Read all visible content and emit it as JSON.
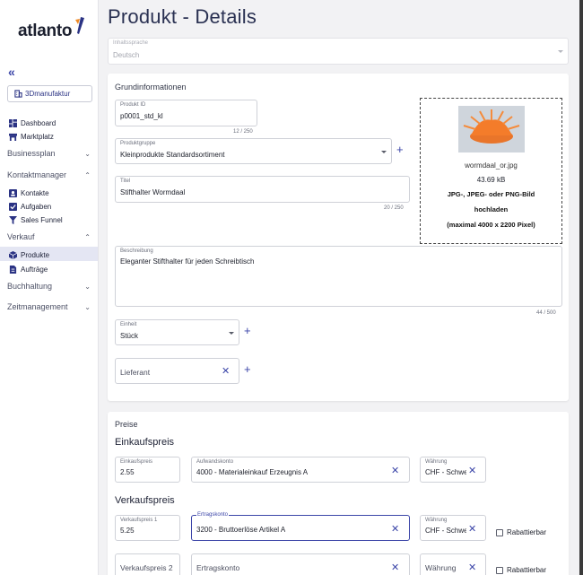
{
  "app": {
    "logo_text": "atlanto",
    "brand_color": "#3b45a8"
  },
  "sidebar": {
    "company_label": "3Dmanufaktur",
    "items_top": [
      {
        "label": "Dashboard",
        "icon": "dashboard-icon"
      },
      {
        "label": "Marktplatz",
        "icon": "store-icon"
      }
    ],
    "sections": {
      "businessplan": "Businessplan",
      "kontaktmanager": "Kontaktmanager",
      "verkauf": "Verkauf",
      "buchhaltung": "Buchhaltung",
      "zeitmanagement": "Zeitmanagement"
    },
    "kontakt_items": [
      {
        "label": "Kontakte",
        "icon": "contacts-icon"
      },
      {
        "label": "Aufgaben",
        "icon": "checkbox-icon"
      },
      {
        "label": "Sales Funnel",
        "icon": "funnel-icon"
      }
    ],
    "verkauf_items": [
      {
        "label": "Produkte",
        "icon": "box-icon",
        "active": true
      },
      {
        "label": "Aufträge",
        "icon": "document-icon"
      }
    ]
  },
  "page": {
    "title": "Produkt - Details"
  },
  "content_language": {
    "label": "Inhaltssprache",
    "value": "Deutsch"
  },
  "grundinfo": {
    "title": "Grundinformationen",
    "product_id": {
      "label": "Produkt ID",
      "value": "p0001_std_kl",
      "counter": "12 / 250"
    },
    "product_group": {
      "label": "Produktgruppe",
      "value": "Kleinprodukte Standardsortiment"
    },
    "titel": {
      "label": "Titel",
      "value": "Stifthalter Wormdaal",
      "counter": "20 / 250"
    },
    "beschreibung": {
      "label": "Beschreibung",
      "value": "Eleganter Stifthalter für jeden Schreibtisch",
      "counter": "44 / 500"
    },
    "einheit": {
      "label": "Einheit",
      "value": "Stück"
    },
    "lieferant": {
      "placeholder": "Lieferant"
    },
    "image": {
      "filename": "wormdaal_or.jpg",
      "filesize": "43.69 kB",
      "hint_line1": "JPG-, JPEG- oder PNG-Bild",
      "hint_line2": "hochladen",
      "hint_line3": "(maximal 4000 x 2200 Pixel)"
    }
  },
  "preise": {
    "title": "Preise",
    "einkauf": {
      "title": "Einkaufspreis",
      "price_label": "Einkaufspreis",
      "price_value": "2.55",
      "konto_label": "Aufwandskonto",
      "konto_value": "4000 - Materialeinkauf Erzeugnis A",
      "currency_label": "Währung",
      "currency_value": "CHF - Schwe"
    },
    "verkauf": {
      "title": "Verkaufspreis",
      "price_label": "Verkaufspreis 1",
      "price_value": "5.25",
      "konto_label": "Ertragskonto",
      "konto_value": "3200 - Bruttoerlöse Artikel A",
      "currency_label": "Währung",
      "currency_value": "CHF - Schwe",
      "rabatt_label": "Rabattierbar"
    },
    "verkauf2": {
      "price_placeholder": "Verkaufspreis 2",
      "konto_placeholder": "Ertragskonto",
      "currency_placeholder": "Währung",
      "rabatt_label": "Rabattierbar"
    }
  }
}
